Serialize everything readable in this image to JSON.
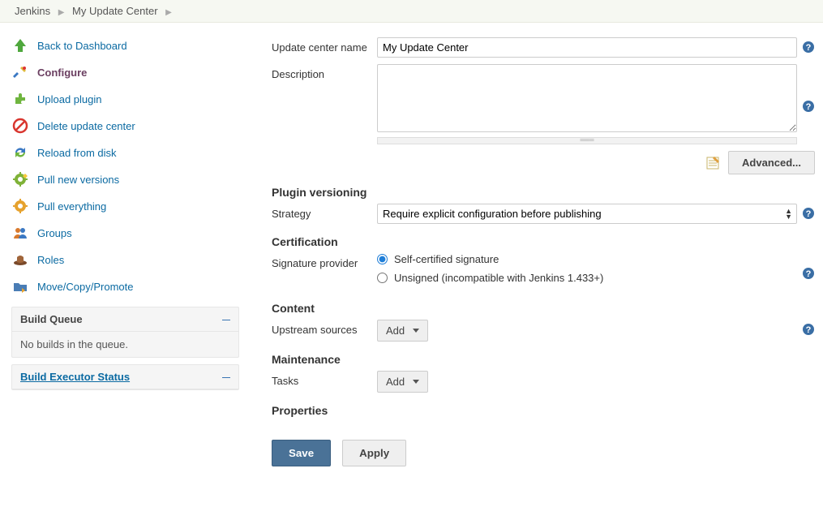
{
  "breadcrumb": {
    "root": "Jenkins",
    "current": "My Update Center"
  },
  "sidebar": {
    "items": [
      {
        "label": "Back to Dashboard"
      },
      {
        "label": "Configure"
      },
      {
        "label": "Upload plugin"
      },
      {
        "label": "Delete update center"
      },
      {
        "label": "Reload from disk"
      },
      {
        "label": "Pull new versions"
      },
      {
        "label": "Pull everything"
      },
      {
        "label": "Groups"
      },
      {
        "label": "Roles"
      },
      {
        "label": "Move/Copy/Promote"
      }
    ],
    "build_queue_title": "Build Queue",
    "build_queue_empty": "No builds in the queue.",
    "executor_title": "Build Executor Status"
  },
  "form": {
    "name_label": "Update center name",
    "name_value": "My Update Center",
    "description_label": "Description",
    "description_value": "",
    "advanced_label": "Advanced...",
    "sections": {
      "plugin_versioning": "Plugin versioning",
      "certification": "Certification",
      "content": "Content",
      "maintenance": "Maintenance",
      "properties": "Properties"
    },
    "strategy_label": "Strategy",
    "strategy_value": "Require explicit configuration before publishing",
    "signature_label": "Signature provider",
    "signature_options": {
      "self": "Self-certified signature",
      "unsigned": "Unsigned (incompatible with Jenkins 1.433+)"
    },
    "upstream_label": "Upstream sources",
    "tasks_label": "Tasks",
    "add_label": "Add",
    "save_label": "Save",
    "apply_label": "Apply"
  }
}
